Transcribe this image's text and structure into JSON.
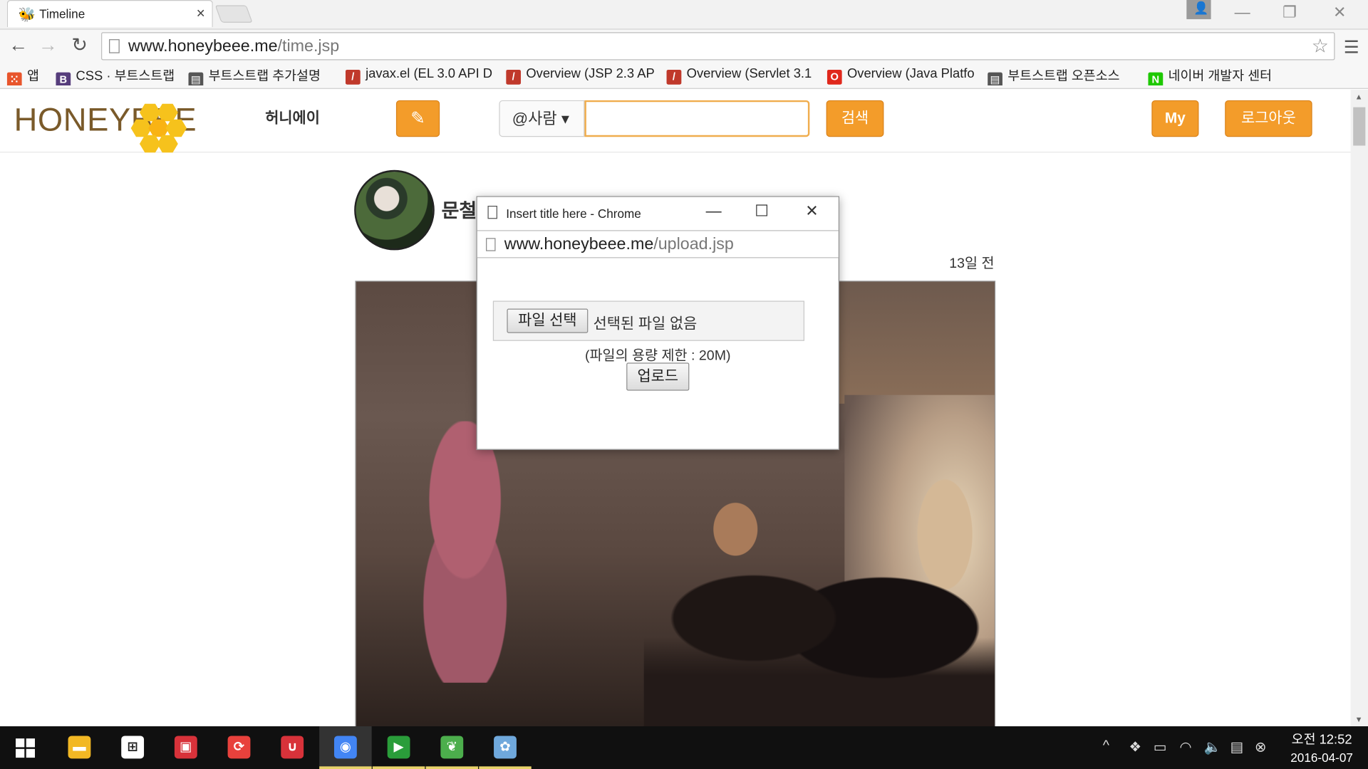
{
  "browser": {
    "tab_title": "Timeline",
    "url_domain": "www.honeybeee.me",
    "url_path": "/time.jsp",
    "bookmarks": [
      {
        "label": "앱",
        "icon": "apps-grid-icon",
        "color": "#e8552c"
      },
      {
        "label": "CSS · 부트스트랩",
        "icon": "bootstrap-icon",
        "color": "#563d7c"
      },
      {
        "label": "부트스트랩 추가설명",
        "icon": "page-icon",
        "color": "#555555"
      },
      {
        "label": "javax.el (EL 3.0 API D",
        "icon": "java-doc-icon",
        "color": "#c0392b"
      },
      {
        "label": "Overview (JSP 2.3 AP",
        "icon": "java-doc-icon",
        "color": "#c0392b"
      },
      {
        "label": "Overview (Servlet 3.1",
        "icon": "java-doc-icon",
        "color": "#c0392b"
      },
      {
        "label": "Overview (Java Platfo",
        "icon": "oracle-icon",
        "color": "#e0281c"
      },
      {
        "label": "부트스트랩 오픈소스",
        "icon": "page-icon",
        "color": "#555555"
      },
      {
        "label": "네이버 개발자 센터",
        "icon": "naver-icon",
        "color": "#1ec800"
      }
    ]
  },
  "site": {
    "logo_text": "HONEYBEE",
    "site_name": "허니에이",
    "search_category": "@사람 ▾",
    "search_value": "",
    "search_button": "검색",
    "my_button": "My",
    "logout_button": "로그아웃",
    "accent_color": "#f39c2a"
  },
  "post": {
    "author": "문철",
    "time": "13일 전"
  },
  "popup": {
    "title": "Insert title here - Chrome",
    "url_domain": "www.honeybeee.me",
    "url_path": "/upload.jsp",
    "file_button": "파일 선택",
    "file_status": "선택된 파일 없음",
    "size_limit": "(파일의 용량 제한 : 20M)",
    "upload_button": "업로드"
  },
  "taskbar": {
    "apps": [
      {
        "name": "file-explorer-icon",
        "color": "#f2b824"
      },
      {
        "name": "store-icon",
        "color": "#ffffff"
      },
      {
        "name": "app-red-icon",
        "color": "#d8323a"
      },
      {
        "name": "sync-icon",
        "color": "#e8413c"
      },
      {
        "name": "magnet-icon",
        "color": "#d8323a"
      },
      {
        "name": "chrome-icon",
        "color": "#4285f4"
      },
      {
        "name": "media-player-icon",
        "color": "#2a9d3a"
      },
      {
        "name": "leaf-app-icon",
        "color": "#4cae4c"
      },
      {
        "name": "paint-icon",
        "color": "#6fa8dc"
      }
    ],
    "time": "오전 12:52",
    "date": "2016-04-07"
  }
}
